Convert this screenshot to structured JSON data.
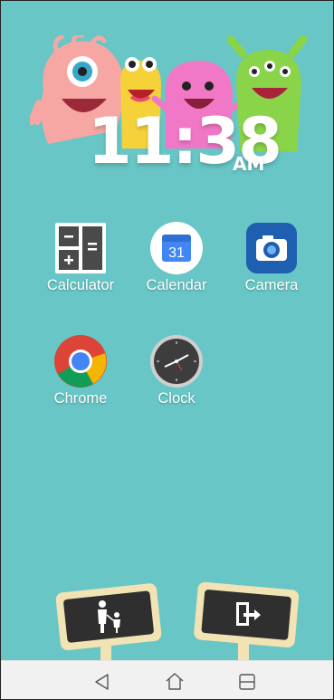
{
  "clock": {
    "time": "11:38",
    "ampm": "AM"
  },
  "apps": [
    {
      "label": "Calculator",
      "icon": "calculator-icon"
    },
    {
      "label": "Calendar",
      "icon": "calendar-icon",
      "badge": "31"
    },
    {
      "label": "Camera",
      "icon": "camera-icon"
    },
    {
      "label": "Chrome",
      "icon": "chrome-icon"
    },
    {
      "label": "Clock",
      "icon": "clock-icon"
    }
  ],
  "signs": {
    "parent_icon": "parent-child-icon",
    "exit_icon": "exit-door-icon"
  },
  "navbar": {
    "back_icon": "back-icon",
    "home_icon": "home-icon",
    "recents_icon": "recents-icon"
  },
  "colors": {
    "background": "#68c6c6",
    "sign_board": "#2f2f2f",
    "sign_frame": "#f2e3b4",
    "navbar": "#f1f1f1"
  }
}
